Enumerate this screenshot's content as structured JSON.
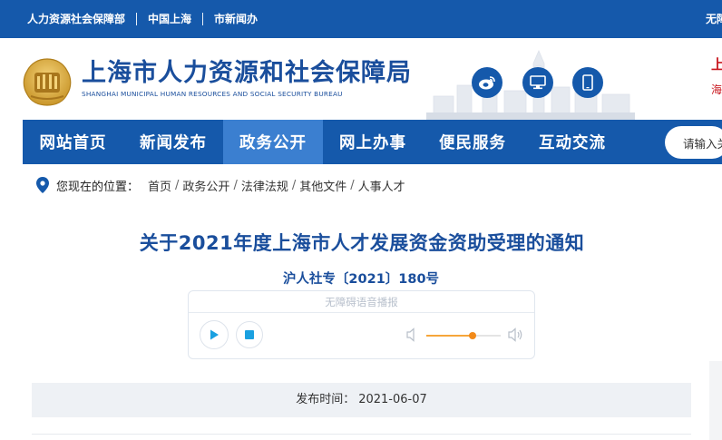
{
  "topbar": {
    "links": [
      "人力资源社会保障部",
      "中国上海",
      "市新闻办"
    ],
    "right_text": "无障"
  },
  "header": {
    "site_name": "上海市人力资源和社会保障局",
    "site_name_en": "SHANGHAI MUNICIPAL HUMAN RESOURCES AND SOCIAL SECURITY BUREAU",
    "icons": [
      "weibo-icon",
      "desktop-icon",
      "mobile-icon"
    ],
    "right_red_line1": "上",
    "right_red_line2": "海"
  },
  "nav": {
    "items": [
      "网站首页",
      "新闻发布",
      "政务公开",
      "网上办事",
      "便民服务",
      "互动交流"
    ],
    "active_index": 2,
    "search_placeholder": "请输入关"
  },
  "breadcrumb": {
    "label": "您现在的位置：",
    "items": [
      "首页",
      "政务公开",
      "法律法规",
      "其他文件",
      "人事人才"
    ]
  },
  "article": {
    "title": "关于2021年度上海市人才发展资金资助受理的通知",
    "doc_number": "沪人社专〔2021〕180号",
    "player": {
      "label": "无障碍语音播报",
      "volume": 0.62
    },
    "publish_label": "发布时间：",
    "publish_date": "2021-06-07"
  },
  "colors": {
    "primary": "#1559ab",
    "nav_active": "#3b7fd0",
    "title": "#1a4e9c",
    "accent_red": "#c8161d",
    "volume": "#f28a1a"
  }
}
